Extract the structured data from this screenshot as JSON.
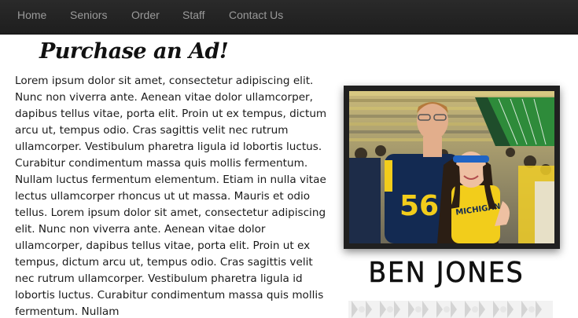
{
  "nav": {
    "items": [
      {
        "label": "Home"
      },
      {
        "label": "Seniors"
      },
      {
        "label": "Order"
      },
      {
        "label": "Staff"
      },
      {
        "label": "Contact Us"
      }
    ]
  },
  "page": {
    "title": "Purchase an Ad!",
    "body": "Lorem ipsum dolor sit amet, consectetur adipiscing elit. Nunc non viverra ante. Aenean vitae dolor ullamcorper, dapibus tellus vitae, porta elit. Proin ut ex tempus, dictum arcu ut, tempus odio. Cras sagittis velit nec rutrum ullamcorper. Vestibulum pharetra ligula id lobortis luctus. Curabitur condimentum massa quis mollis fermentum. Nullam luctus fermentum elementum. Etiam in nulla vitae lectus ullamcorper rhoncus ut ut massa. Mauris et odio tellus. Lorem ipsum dolor sit amet, consectetur adipiscing elit. Nunc non viverra ante. Aenean vitae dolor ullamcorper, dapibus tellus vitae, porta elit. Proin ut ex tempus, dictum arcu ut, tempus odio. Cras sagittis velit nec rutrum ullamcorper. Vestibulum pharetra ligula id lobortis luctus. Curabitur condimentum massa quis mollis fermentum. Nullam"
  },
  "feature": {
    "name": "BEN JONES",
    "photo_jersey_number": "56",
    "photo_shirt_text": "MICHIGAN"
  },
  "colors": {
    "navbar_bg": "#222222",
    "nav_text": "#9a9a9a",
    "maize": "#f2cd1b",
    "navy": "#0f2747"
  }
}
